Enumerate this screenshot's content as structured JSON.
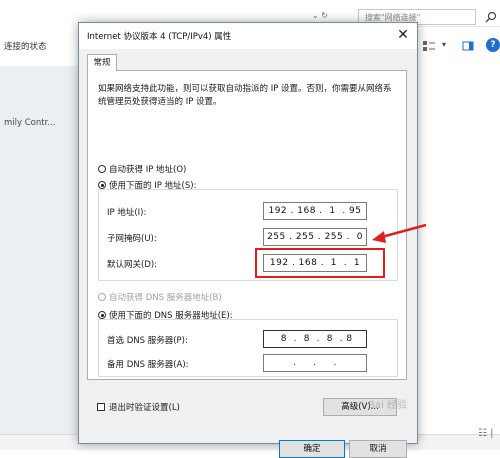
{
  "background": {
    "search_placeholder": "搜索\"网络连接\"",
    "nav_arrows": "⌄ ↻",
    "left_header": "连接的状态",
    "left_item": "mily Contr...",
    "grid_icon": "☷ |"
  },
  "dialog": {
    "title": "Internet 协议版本 4 (TCP/IPv4) 属性",
    "close_label": "✕",
    "tab": "常规",
    "description": "如果网络支持此功能，则可以获取自动指派的 IP 设置。否则，你需要从网络系统管理员处获得适当的 IP 设置。",
    "ip_auto_label": "自动获得 IP 地址(O)",
    "ip_manual_label": "使用下面的 IP 地址(S):",
    "ip_address_label": "IP 地址(I):",
    "ip_address_value": "192 . 168 .  1  . 95",
    "subnet_label": "子网掩码(U):",
    "subnet_value": "255 . 255 . 255 .  0",
    "gateway_label": "默认网关(D):",
    "gateway_value": "192 . 168 .  1  .  1",
    "dns_auto_label": "自动获得 DNS 服务器地址(B)",
    "dns_manual_label": "使用下面的 DNS 服务器地址(E):",
    "preferred_dns_label": "首选 DNS 服务器(P):",
    "preferred_dns_value": " 8  .  8  .  8  . 8",
    "alternate_dns_label": "备用 DNS 服务器(A):",
    "alternate_dns_value": "    .     .     .    ",
    "validate_label": "退出时验证设置(L)",
    "advanced_label": "高级(V)...",
    "ok_label": "确定",
    "cancel_label": "取消"
  },
  "watermark": "Bai 经验",
  "colors": {
    "highlight": "#e02020",
    "accent": "#0078d7"
  }
}
